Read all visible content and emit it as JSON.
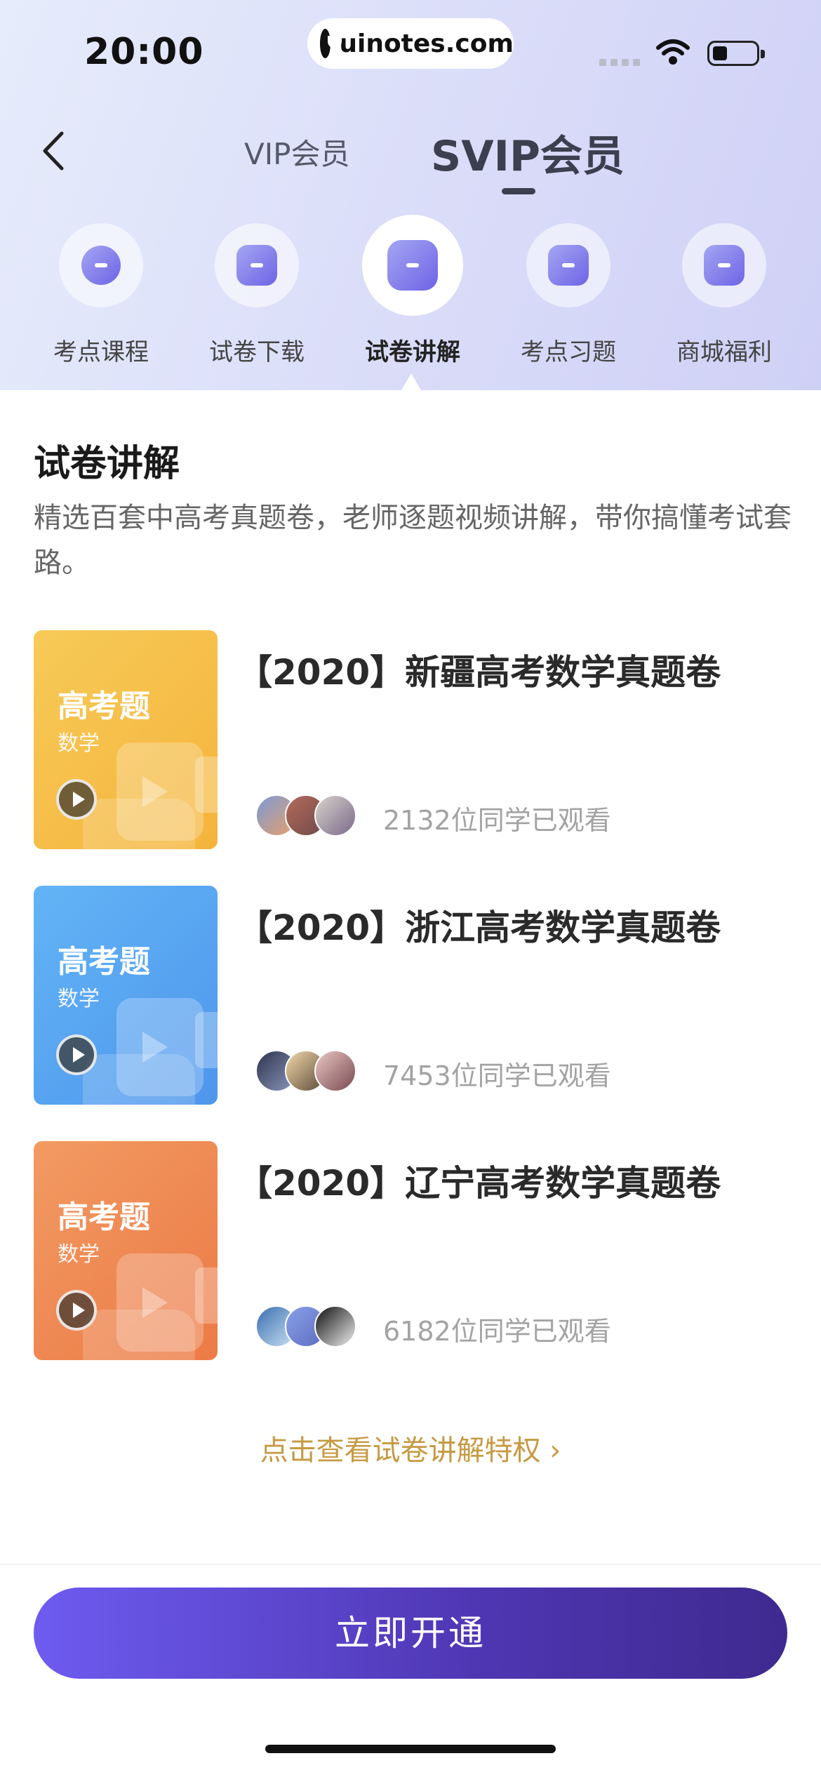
{
  "status_bar": {
    "time": "20:00",
    "url": "uinotes.com"
  },
  "nav": {
    "tabs": [
      "VIP会员",
      "SVIP会员"
    ],
    "active_tab": "SVIP会员"
  },
  "categories": [
    {
      "label": "考点课程",
      "icon": "star-bulb-icon"
    },
    {
      "label": "试卷下载",
      "icon": "download-box-icon"
    },
    {
      "label": "试卷讲解",
      "icon": "paper-lecture-icon"
    },
    {
      "label": "考点习题",
      "icon": "exercise-list-icon"
    },
    {
      "label": "商城福利",
      "icon": "coupon-ticket-icon"
    }
  ],
  "active_category": "试卷讲解",
  "section": {
    "title": "试卷讲解",
    "description": "精选百套中高考真题卷，老师逐题视频讲解，带你搞懂考试套路。"
  },
  "courses": [
    {
      "thumb_title": "高考题",
      "thumb_subject": "数学",
      "title": "【2020】新疆高考数学真题卷",
      "viewers": "2132位同学已观看",
      "color": "#f6c24e"
    },
    {
      "thumb_title": "高考题",
      "thumb_subject": "数学",
      "title": "【2020】浙江高考数学真题卷",
      "viewers": "7453位同学已观看",
      "color": "#5aa8f4"
    },
    {
      "thumb_title": "高考题",
      "thumb_subject": "数学",
      "title": "【2020】辽宁高考数学真题卷",
      "viewers": "6182位同学已观看",
      "color": "#f08a55"
    }
  ],
  "privilege_link": "点击查看试卷讲解特权 ›",
  "cta": "立即开通",
  "colors": {
    "accent": "#6e5bf0",
    "link": "#c69a43",
    "header_bg": "#dcdff9"
  }
}
